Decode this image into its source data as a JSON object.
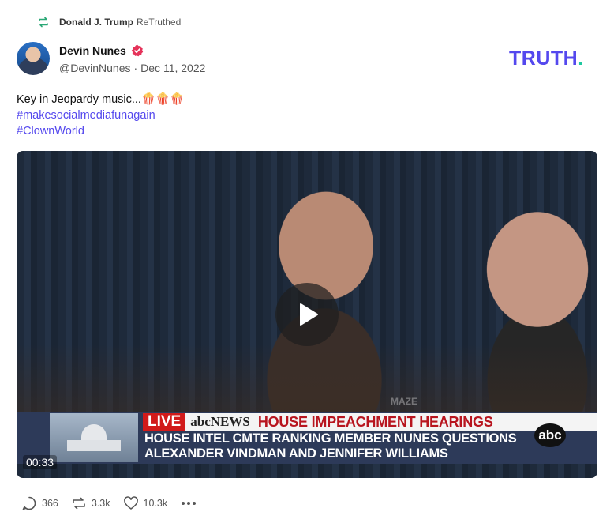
{
  "retruth": {
    "user": "Donald J. Trump",
    "action": "ReTruthed",
    "icon": "retruth-icon"
  },
  "author": {
    "name": "Devin Nunes",
    "handle": "@DevinNunes",
    "separator": "·",
    "date": "Dec 11, 2022",
    "verified_icon": "verified-badge-icon"
  },
  "brand": {
    "text": "TRUTH",
    "dot": "."
  },
  "post": {
    "text": "Key in Jeopardy music...🍿🍿🍿",
    "hashtags": [
      "#makesocialmediafunagain",
      "#ClownWorld"
    ]
  },
  "video": {
    "duration": "00:33",
    "live_label": "LIVE",
    "network": "abcNEWS",
    "headline": "HOUSE IMPEACHMENT HEARINGS",
    "subline_1": "HOUSE INTEL CMTE RANKING MEMBER NUNES QUESTIONS",
    "subline_2": "ALEXANDER VINDMAN AND JENNIFER WILLIAMS",
    "logo": "abc",
    "watermark": "MAZE"
  },
  "actions": {
    "replies": "366",
    "retruths": "3.3k",
    "likes": "10.3k"
  },
  "colors": {
    "brand": "#5448ee",
    "brand_dot": "#1ec8a0",
    "hashtag": "#5448ee",
    "verified": "#e5335a"
  }
}
